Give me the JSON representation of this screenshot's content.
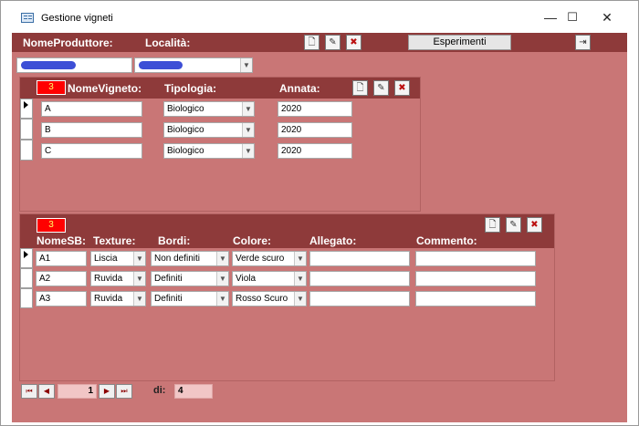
{
  "window": {
    "title": "Gestione vigneti",
    "minimize_glyph": "—",
    "maximize_glyph": "☐",
    "close_glyph": "✕"
  },
  "header": {
    "produttore_label": "NomeProduttore:",
    "localita_label": "Località:",
    "esperimenti_label": "Esperimenti"
  },
  "toolbar_icons": {
    "new": "🗋",
    "edit": "✎",
    "delete": "✖",
    "exit": "⇥"
  },
  "vigneti": {
    "counter": "3",
    "columns": {
      "nome": "NomeVigneto:",
      "tipologia": "Tipologia:",
      "annata": "Annata:"
    },
    "rows": [
      {
        "nome": "A",
        "tipologia": "Biologico",
        "annata": "2020"
      },
      {
        "nome": "B",
        "tipologia": "Biologico",
        "annata": "2020"
      },
      {
        "nome": "C",
        "tipologia": "Biologico",
        "annata": "2020"
      }
    ]
  },
  "sb": {
    "counter": "3",
    "columns": {
      "nome": "NomeSB:",
      "texture": "Texture:",
      "bordi": "Bordi:",
      "colore": "Colore:",
      "allegato": "Allegato:",
      "commento": "Commento:"
    },
    "rows": [
      {
        "nome": "A1",
        "texture": "Liscia",
        "bordi": "Non definiti",
        "colore": "Verde scuro"
      },
      {
        "nome": "A2",
        "texture": "Ruvida",
        "bordi": "Definiti",
        "colore": "Viola"
      },
      {
        "nome": "A3",
        "texture": "Ruvida",
        "bordi": "Definiti",
        "colore": "Rosso Scuro"
      }
    ]
  },
  "navigator": {
    "first": "⏮",
    "prev": "◀",
    "current": "1",
    "next": "▶",
    "last": "⏭",
    "of_label": "di:",
    "total": "4"
  },
  "colors": {
    "form_bg": "#c97676",
    "band": "#8e3a3a",
    "counter_bg": "#ff0000",
    "counter_text": "#ffff66",
    "redacted": "#3d4fd6"
  }
}
